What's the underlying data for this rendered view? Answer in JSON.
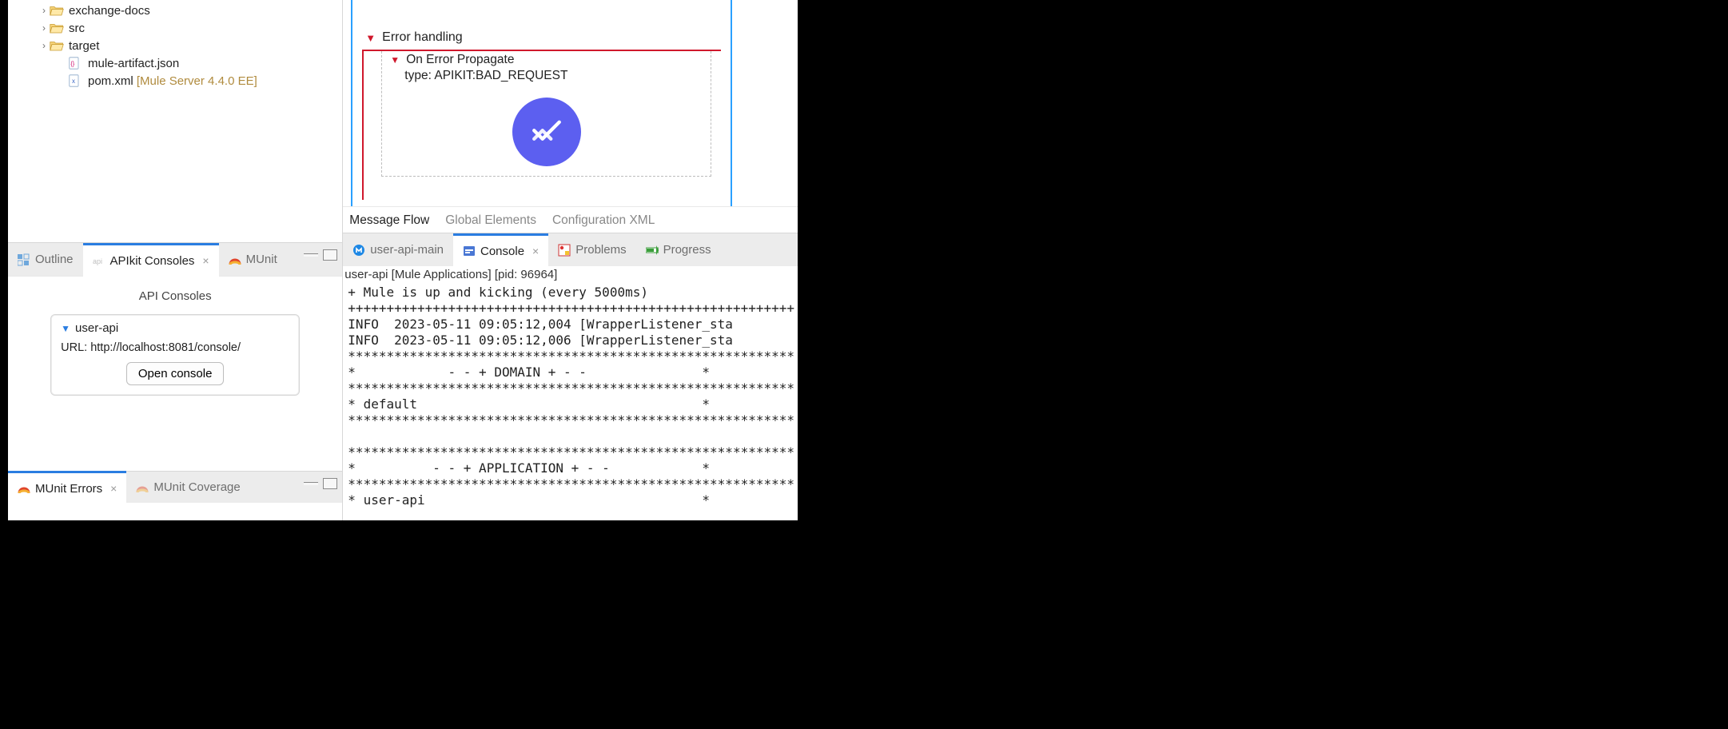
{
  "project_tree": {
    "items": [
      {
        "indent": 28,
        "twisty": "›",
        "icon": "folder-open",
        "label": "exchange-docs"
      },
      {
        "indent": 28,
        "twisty": "›",
        "icon": "folder-open",
        "label": "src"
      },
      {
        "indent": 28,
        "twisty": "›",
        "icon": "folder-open",
        "label": "target"
      },
      {
        "indent": 52,
        "twisty": "",
        "icon": "json-file",
        "label": "mule-artifact.json"
      },
      {
        "indent": 52,
        "twisty": "",
        "icon": "xml-file",
        "label": "pom.xml",
        "decor": "[Mule Server 4.4.0 EE]"
      }
    ]
  },
  "lower_left": {
    "tabs": {
      "outline": "Outline",
      "apikit": "APIkit Consoles",
      "munit": "MUnit"
    },
    "panel_title": "API Consoles",
    "card": {
      "name": "user-api",
      "url_label": "URL: http://localhost:8081/console/",
      "open_btn": "Open console"
    },
    "tabs2": {
      "errors": "MUnit Errors",
      "coverage": "MUnit Coverage"
    }
  },
  "editor": {
    "error_section": "Error handling",
    "scope_name": "On Error Propagate",
    "scope_type": "type: APIKIT:BAD_REQUEST",
    "tabs": {
      "flow": "Message Flow",
      "global": "Global Elements",
      "xml": "Configuration XML"
    }
  },
  "bottom_right": {
    "tabs": {
      "main": "user-api-main",
      "console": "Console",
      "problems": "Problems",
      "progress": "Progress"
    },
    "terminated": "user-api [Mule Applications]  [pid: 96964]",
    "lines": [
      "+ Mule is up and kicking (every 5000ms)",
      "++++++++++++++++++++++++++++++++++++++++++++++++++++++++++",
      "INFO  2023-05-11 09:05:12,004 [WrapperListener_sta",
      "INFO  2023-05-11 09:05:12,006 [WrapperListener_sta",
      "**********************************************************",
      "*            - - + DOMAIN + - -               *",
      "**********************************************************",
      "* default                                     *",
      "**********************************************************",
      "",
      "**********************************************************",
      "*          - - + APPLICATION + - -            *",
      "**********************************************************",
      "* user-api                                    *"
    ]
  }
}
